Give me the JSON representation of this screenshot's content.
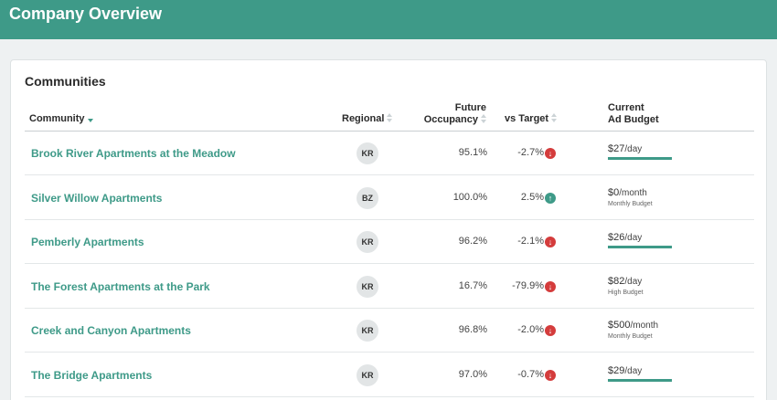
{
  "header": {
    "title": "Company Overview"
  },
  "card": {
    "title": "Communities"
  },
  "columns": {
    "community": "Community",
    "regional": "Regional",
    "future_line1": "Future",
    "future_line2": "Occupancy",
    "vs_target": "vs Target",
    "budget_line1": "Current",
    "budget_line2": "Ad Budget"
  },
  "rows": [
    {
      "name": "Brook River Apartments at the Meadow",
      "regional": "KR",
      "occupancy": "95.1%",
      "vs_target": "-2.7%",
      "trend": "down",
      "budget": "$27",
      "period": "/day",
      "note": "",
      "bar": true
    },
    {
      "name": "Silver Willow Apartments",
      "regional": "BZ",
      "occupancy": "100.0%",
      "vs_target": "2.5%",
      "trend": "up",
      "budget": "$0",
      "period": "/month",
      "note": "Monthly Budget",
      "bar": false
    },
    {
      "name": "Pemberly Apartments",
      "regional": "KR",
      "occupancy": "96.2%",
      "vs_target": "-2.1%",
      "trend": "down",
      "budget": "$26",
      "period": "/day",
      "note": "",
      "bar": true
    },
    {
      "name": "The Forest Apartments at the Park",
      "regional": "KR",
      "occupancy": "16.7%",
      "vs_target": "-79.9%",
      "trend": "down",
      "budget": "$82",
      "period": "/day",
      "note": "High Budget",
      "bar": false
    },
    {
      "name": "Creek and Canyon Apartments",
      "regional": "KR",
      "occupancy": "96.8%",
      "vs_target": "-2.0%",
      "trend": "down",
      "budget": "$500",
      "period": "/month",
      "note": "Monthly Budget",
      "bar": false
    },
    {
      "name": "The Bridge Apartments",
      "regional": "KR",
      "occupancy": "97.0%",
      "vs_target": "-0.7%",
      "trend": "down",
      "budget": "$29",
      "period": "/day",
      "note": "",
      "bar": true
    }
  ],
  "colors": {
    "accent": "#3e9a88",
    "negative": "#d43c3c"
  },
  "icons": {
    "down": "arrow-down-circle-icon",
    "up": "arrow-up-circle-icon"
  }
}
